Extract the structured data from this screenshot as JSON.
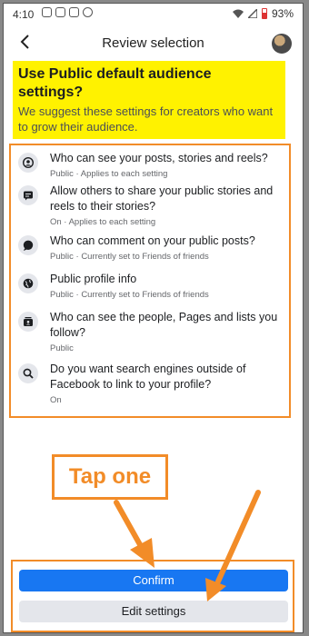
{
  "status": {
    "time": "4:10",
    "battery": "93%",
    "icons": [
      "instagram-icon",
      "instagram-icon",
      "instagram-icon",
      "slack-icon",
      "wifi-icon",
      "signal-icon",
      "battery-icon"
    ]
  },
  "header": {
    "title": "Review selection"
  },
  "banner": {
    "title": "Use Public default audience settings?",
    "subtitle": "We suggest these settings for creators who want to grow their audience."
  },
  "settings": [
    {
      "question": "Who can see your posts, stories and reels?",
      "detail": "Public · Applies to each setting",
      "icon": "person-circle-icon"
    },
    {
      "question": "Allow others to share your public stories and reels to their stories?",
      "detail": "On · Applies to each setting",
      "icon": "share-story-icon"
    },
    {
      "question": "Who can comment on your public posts?",
      "detail": "Public · Currently set to Friends of friends",
      "icon": "comment-icon"
    },
    {
      "question": "Public profile info",
      "detail": "Public · Currently set to Friends of friends",
      "icon": "globe-icon"
    },
    {
      "question": "Who can see the people, Pages and lists you follow?",
      "detail": "Public",
      "icon": "lists-icon"
    },
    {
      "question": "Do you want search engines outside of Facebook to link to your profile?",
      "detail": "On",
      "icon": "search-icon"
    }
  ],
  "annotation": {
    "label": "Tap one"
  },
  "actions": {
    "confirm": "Confirm",
    "edit": "Edit settings"
  },
  "colors": {
    "highlight": "#fff200",
    "annotation": "#f28c28",
    "primary": "#1877f2"
  }
}
